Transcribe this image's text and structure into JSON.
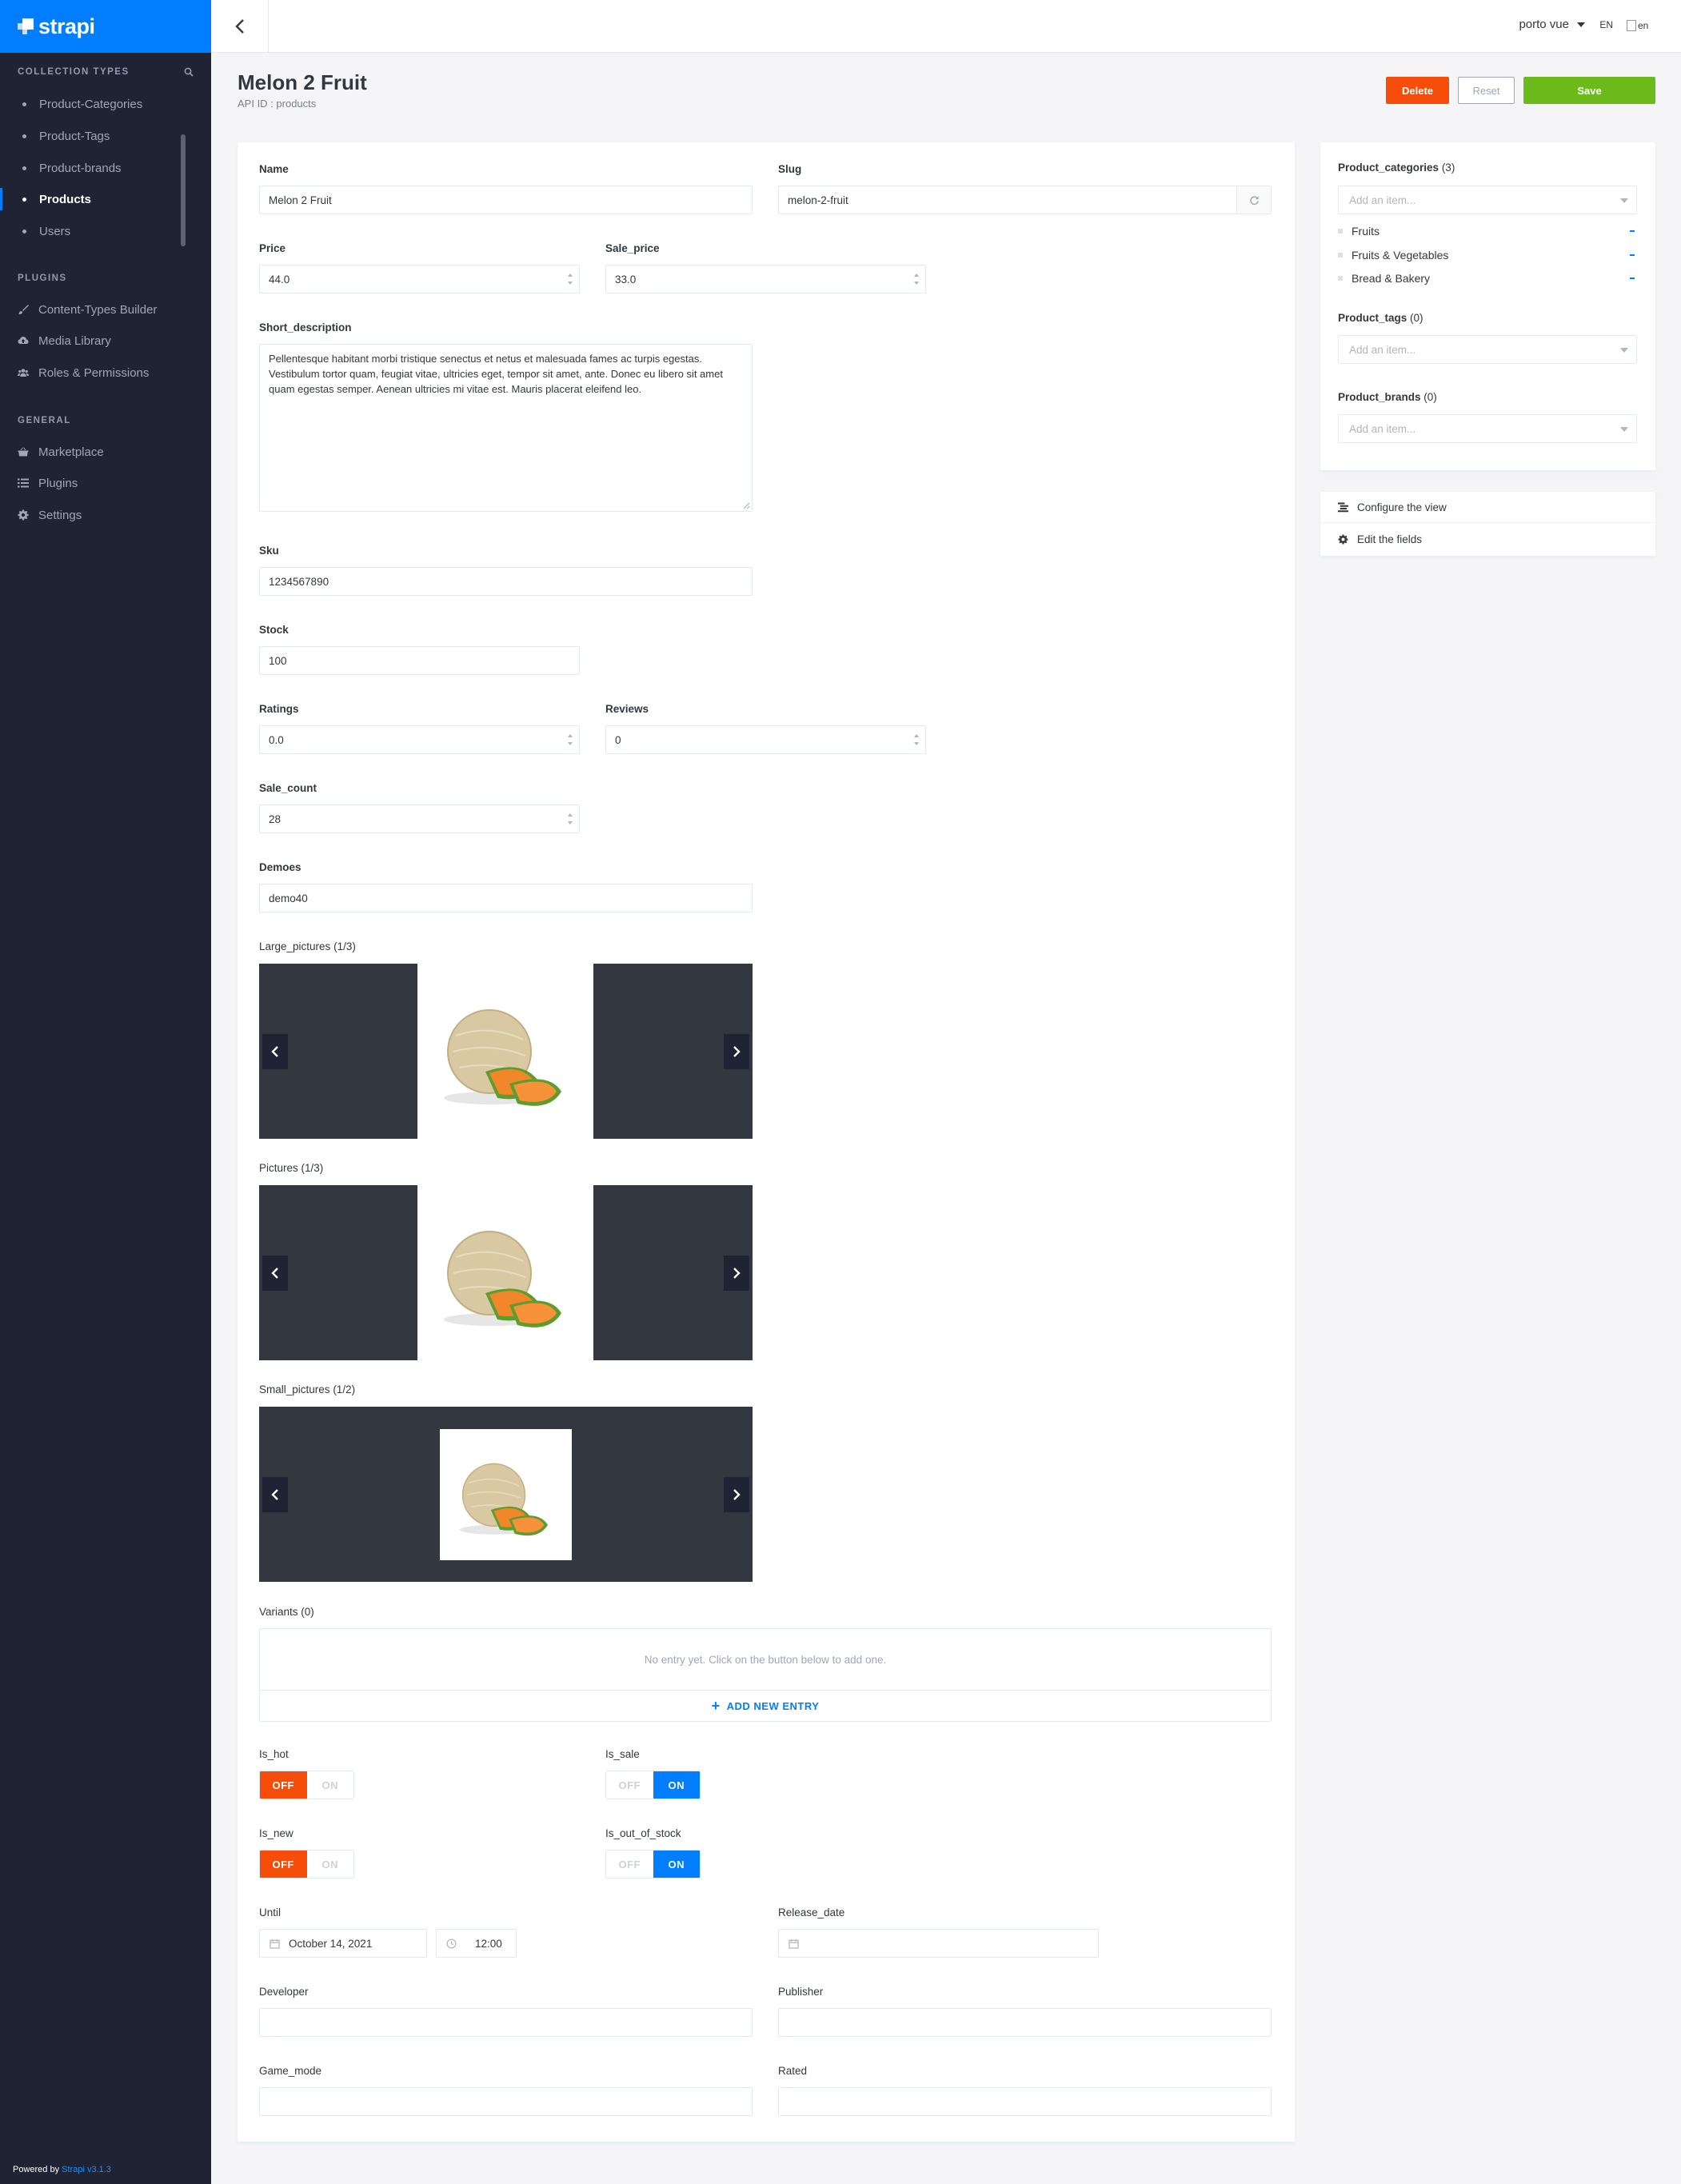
{
  "app": {
    "brand": "strapi",
    "powered_by": "Powered by",
    "version": "Strapi v3.1.3"
  },
  "sidebar": {
    "collection_types_title": "COLLECTION TYPES",
    "collection_types": [
      {
        "label": "Product-Categories",
        "active": false
      },
      {
        "label": "Product-Tags",
        "active": false
      },
      {
        "label": "Product-brands",
        "active": false
      },
      {
        "label": "Products",
        "active": true
      },
      {
        "label": "Users",
        "active": false
      }
    ],
    "plugins_title": "PLUGINS",
    "plugins": [
      {
        "label": "Content-Types Builder",
        "icon": "paintbrush-icon"
      },
      {
        "label": "Media Library",
        "icon": "cloud-upload-icon"
      },
      {
        "label": "Roles & Permissions",
        "icon": "users-icon"
      }
    ],
    "general_title": "GENERAL",
    "general": [
      {
        "label": "Marketplace",
        "icon": "shopping-basket-icon"
      },
      {
        "label": "Plugins",
        "icon": "list-icon"
      },
      {
        "label": "Settings",
        "icon": "gear-icon"
      }
    ]
  },
  "header": {
    "user": "porto vue",
    "lang": "EN",
    "flag_alt": "en"
  },
  "page": {
    "title": "Melon 2 Fruit",
    "subtitle": "API ID : products"
  },
  "actions": {
    "delete": "Delete",
    "reset": "Reset",
    "save": "Save"
  },
  "fields": {
    "name": {
      "label": "Name",
      "value": "Melon 2 Fruit"
    },
    "slug": {
      "label": "Slug",
      "value": "melon-2-fruit"
    },
    "price": {
      "label": "Price",
      "value": "44.0"
    },
    "sale_price": {
      "label": "Sale_price",
      "value": "33.0"
    },
    "short_description": {
      "label": "Short_description",
      "value": "Pellentesque habitant morbi tristique senectus et netus et malesuada fames ac turpis egestas. Vestibulum tortor quam, feugiat vitae, ultricies eget, tempor sit amet, ante. Donec eu libero sit amet quam egestas semper. Aenean ultricies mi vitae est. Mauris placerat eleifend leo."
    },
    "sku": {
      "label": "Sku",
      "value": "1234567890"
    },
    "stock": {
      "label": "Stock",
      "value": "100"
    },
    "ratings": {
      "label": "Ratings",
      "value": "0.0"
    },
    "reviews": {
      "label": "Reviews",
      "value": "0"
    },
    "sale_count": {
      "label": "Sale_count",
      "value": "28"
    },
    "demoes": {
      "label": "Demoes",
      "value": "demo40"
    },
    "large_pictures": {
      "label": "Large_pictures",
      "count": "(1/3)"
    },
    "pictures": {
      "label": "Pictures",
      "count": "(1/3)"
    },
    "small_pictures": {
      "label": "Small_pictures",
      "count": "(1/2)"
    },
    "variants": {
      "label": "Variants",
      "count": "(0)",
      "empty_text": "No entry yet. Click on the button below to add one.",
      "add_label": "ADD NEW ENTRY"
    },
    "is_hot": {
      "label": "Is_hot",
      "off": "OFF",
      "on": "ON",
      "state": "off"
    },
    "is_sale": {
      "label": "Is_sale",
      "off": "OFF",
      "on": "ON",
      "state": "on"
    },
    "is_new": {
      "label": "Is_new",
      "off": "OFF",
      "on": "ON",
      "state": "off"
    },
    "is_out_of_stock": {
      "label": "Is_out_of_stock",
      "off": "OFF",
      "on": "ON",
      "state": "on"
    },
    "until": {
      "label": "Until",
      "date": "October 14, 2021",
      "time": "12:00"
    },
    "release_date": {
      "label": "Release_date",
      "value": ""
    },
    "developer": {
      "label": "Developer",
      "value": ""
    },
    "publisher": {
      "label": "Publisher",
      "value": ""
    },
    "game_mode": {
      "label": "Game_mode",
      "value": ""
    },
    "rated": {
      "label": "Rated",
      "value": ""
    }
  },
  "relations": {
    "product_categories": {
      "label": "Product_categories",
      "count": "(3)",
      "placeholder": "Add an item...",
      "items": [
        "Fruits",
        "Fruits & Vegetables",
        "Bread & Bakery"
      ]
    },
    "product_tags": {
      "label": "Product_tags",
      "count": "(0)",
      "placeholder": "Add an item..."
    },
    "product_brands": {
      "label": "Product_brands",
      "count": "(0)",
      "placeholder": "Add an item..."
    }
  },
  "side_links": {
    "configure": "Configure the view",
    "edit_fields": "Edit the fields"
  },
  "colors": {
    "primary": "#007eff",
    "danger": "#f64d0a",
    "success": "#6dbb1a",
    "sidebar": "#1f2333"
  }
}
